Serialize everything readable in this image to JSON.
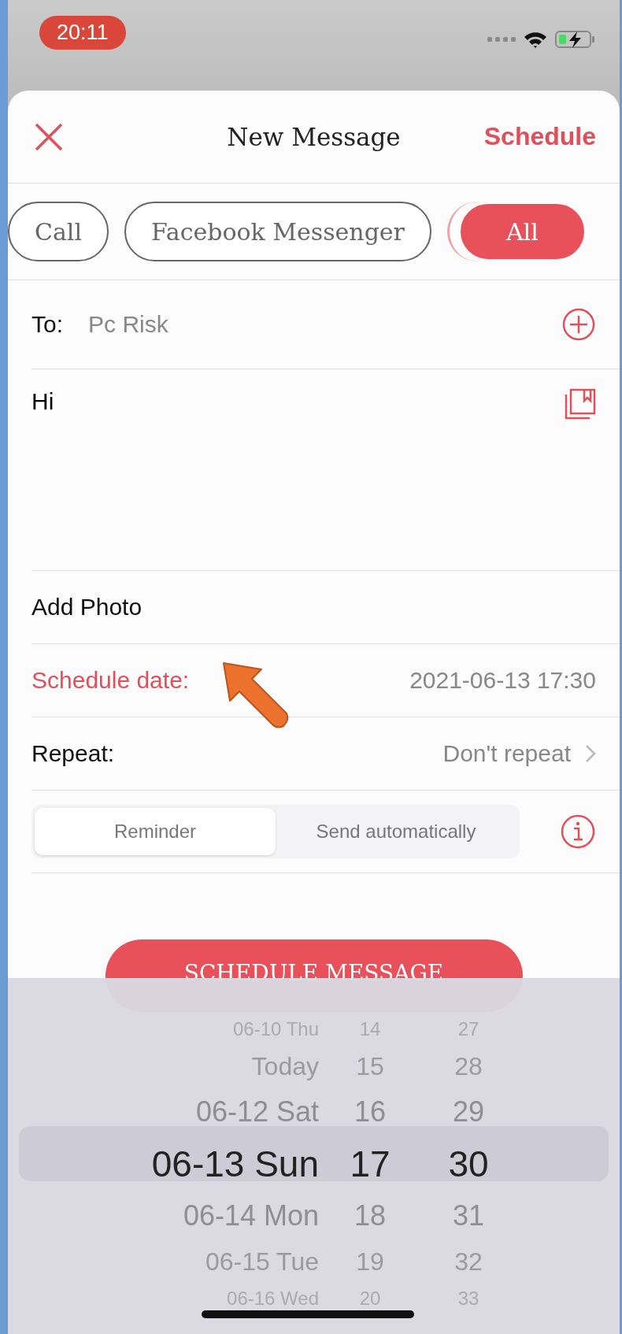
{
  "status_bar": {
    "time": "20:11"
  },
  "header": {
    "title": "New Message",
    "action": "Schedule"
  },
  "chips": [
    {
      "label": "Call",
      "selected": false
    },
    {
      "label": "Facebook Messenger",
      "selected": false
    },
    {
      "label": "All",
      "selected": true
    }
  ],
  "to": {
    "label": "To:",
    "value": "Pc Risk"
  },
  "message": {
    "value": "Hi"
  },
  "add_photo": "Add Photo",
  "schedule_date": {
    "label": "Schedule date:",
    "value": "2021-06-13 17:30"
  },
  "repeat": {
    "label": "Repeat:",
    "value": "Don't repeat"
  },
  "mode": [
    {
      "label": "Reminder",
      "selected": true
    },
    {
      "label": "Send automatically",
      "selected": false
    }
  ],
  "button": "SCHEDULE MESSAGE",
  "picker": {
    "rows": [
      {
        "date": "06-10 Thu",
        "hour": "14",
        "minute": "27",
        "selected": false
      },
      {
        "date": "Today",
        "hour": "15",
        "minute": "28",
        "selected": false
      },
      {
        "date": "06-12 Sat",
        "hour": "16",
        "minute": "29",
        "selected": false
      },
      {
        "date": "06-13 Sun",
        "hour": "17",
        "minute": "30",
        "selected": true
      },
      {
        "date": "06-14 Mon",
        "hour": "18",
        "minute": "31",
        "selected": false
      },
      {
        "date": "06-15 Tue",
        "hour": "19",
        "minute": "32",
        "selected": false
      },
      {
        "date": "06-16 Wed",
        "hour": "20",
        "minute": "33",
        "selected": false
      }
    ]
  }
}
